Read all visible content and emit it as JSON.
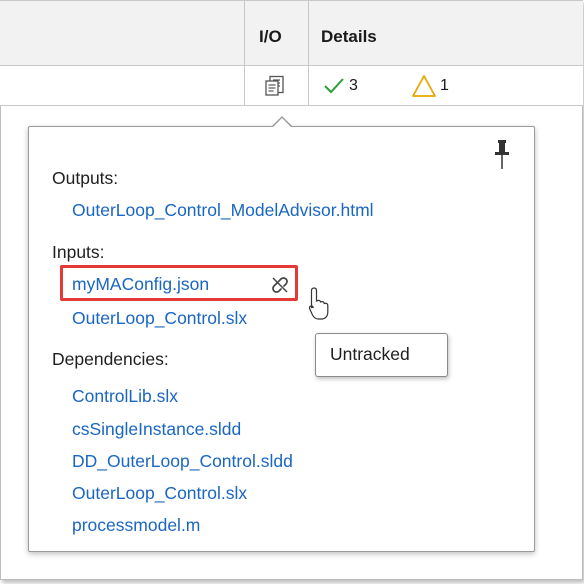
{
  "table": {
    "header": {
      "io_label": "I/O",
      "details_label": "Details"
    },
    "row": {
      "io_icon": "report-document-icon",
      "pass_count": "3",
      "warning_count": "1"
    }
  },
  "popover": {
    "outputs_label": "Outputs:",
    "outputs": [
      "OuterLoop_Control_ModelAdvisor.html"
    ],
    "inputs_label": "Inputs:",
    "inputs": [
      "myMAConfig.json",
      "OuterLoop_Control.slx"
    ],
    "dependencies_label": "Dependencies:",
    "dependencies": [
      "ControlLib.slx",
      "csSingleInstance.sldd",
      "DD_OuterLoop_Control.sldd",
      "OuterLoop_Control.slx",
      "processmodel.m"
    ],
    "pin_icon": "pin-icon",
    "untracked_icon": "unlink-icon"
  },
  "tooltip": {
    "text": "Untracked"
  },
  "colors": {
    "link": "#1a66c2",
    "highlight": "#e53935",
    "pass": "#2e9e3a",
    "warning": "#e8a800"
  }
}
